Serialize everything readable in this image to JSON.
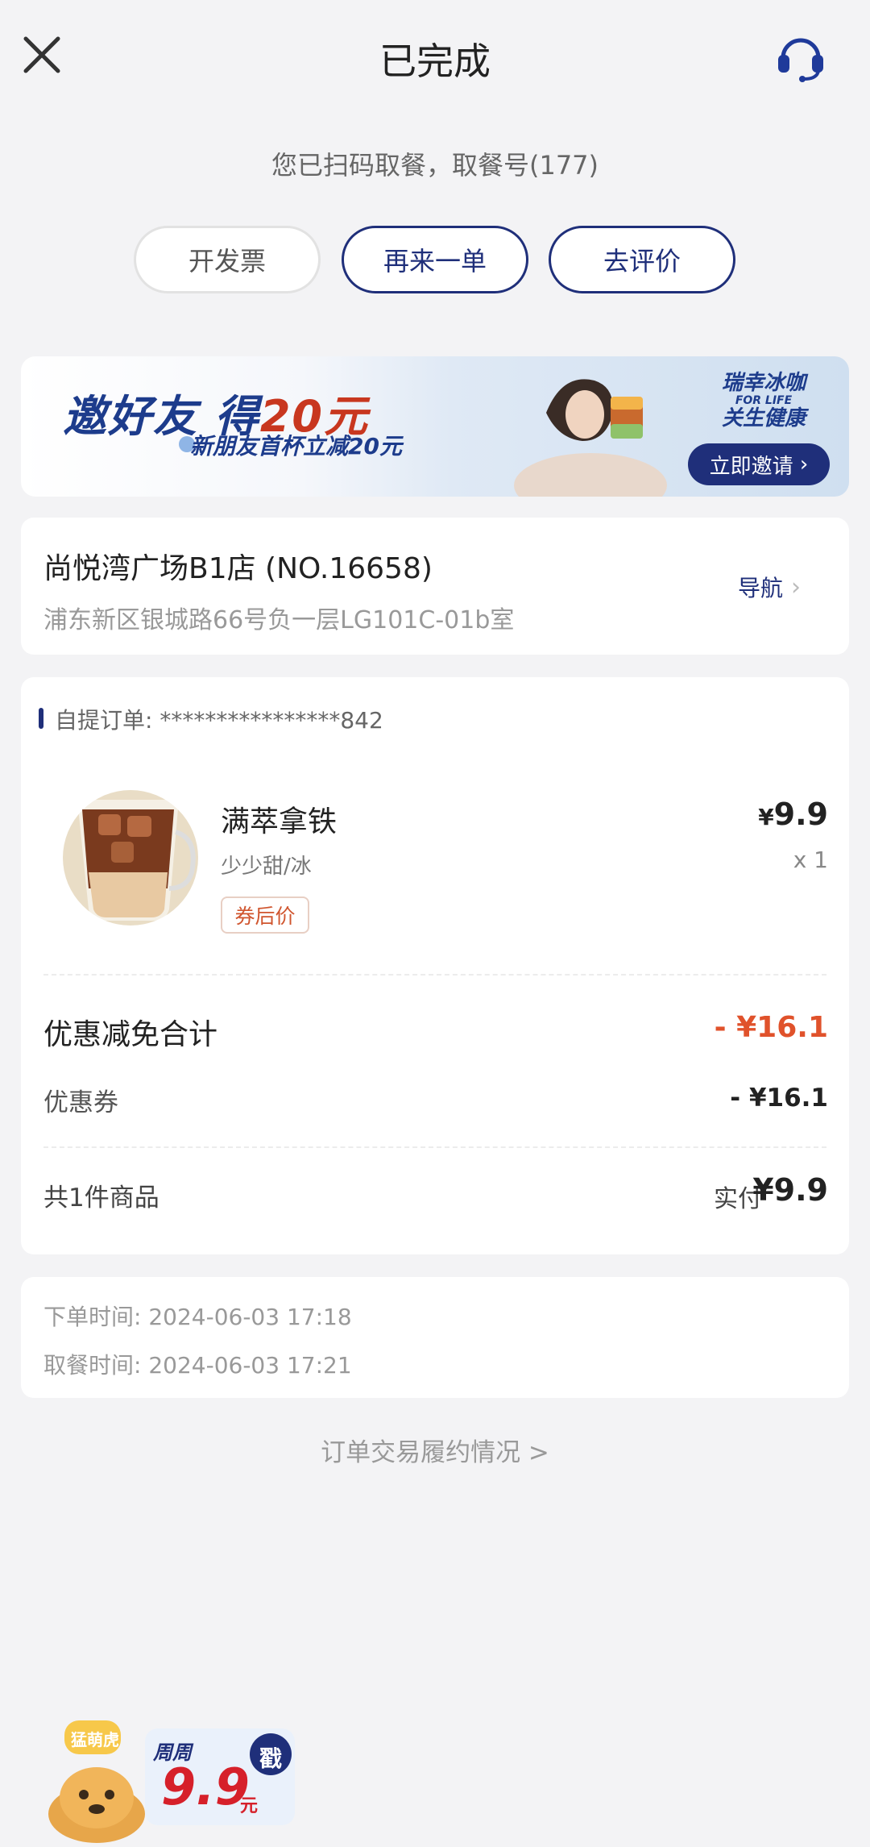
{
  "header": {
    "title": "已完成",
    "close_icon": "close-icon",
    "service_icon": "customer-service-headset-icon"
  },
  "pickup_notice": "您已扫码取餐，取餐号(177)",
  "actions": {
    "invoice": "开发票",
    "reorder": "再来一单",
    "review": "去评价"
  },
  "banner": {
    "title_a": "邀好友 得",
    "title_b": "20元",
    "subtitle": "新朋友首杯立减20元",
    "slogan_line1": "瑞幸冰咖",
    "slogan_line2": "关生健康",
    "slogan_en": "FOR LIFE",
    "invite_label": "立即邀请"
  },
  "store": {
    "name": "尚悦湾广场B1店 (NO.16658)",
    "address": "浦东新区银城路66号负一层LG101C-01b室",
    "nav_label": "导航",
    "nav_chevron": "›"
  },
  "order": {
    "id_label": "自提订单: ****************842",
    "product": {
      "name": "满萃拿铁",
      "spec": "少少甜/冰",
      "badge": "券后价",
      "currency": "¥",
      "price": "9.9",
      "qty": "x 1"
    },
    "discount_total_label": "优惠减免合计",
    "discount_total_value": "- ¥16.1",
    "coupon_label": "优惠券",
    "coupon_value": "- ¥16.1",
    "item_count_label": "共1件商品",
    "paid_label": "实付",
    "paid_value": "¥9.9"
  },
  "times": {
    "order_time": "下单时间:  2024-06-03 17:18",
    "pickup_time": "取餐时间:  2024-06-03 17:21"
  },
  "fulfilment_link": "订单交易履约情况 >",
  "promo": {
    "tag": "猛萌虎",
    "title": "周周",
    "price": "9.9",
    "unit": "元",
    "stamp": "戳"
  },
  "colors": {
    "brand_navy": "#1f2f7a",
    "discount_red": "#e0522b",
    "background": "#f3f3f5"
  }
}
